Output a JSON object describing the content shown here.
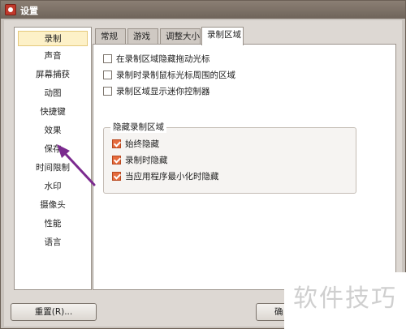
{
  "window": {
    "title": "设置"
  },
  "sidebar": {
    "items": [
      {
        "label": "录制",
        "selected": true
      },
      {
        "label": "声音"
      },
      {
        "label": "屏幕捕获"
      },
      {
        "label": "动图"
      },
      {
        "label": "快捷键"
      },
      {
        "label": "效果"
      },
      {
        "label": "保存"
      },
      {
        "label": "时间限制"
      },
      {
        "label": "水印"
      },
      {
        "label": "摄像头"
      },
      {
        "label": "性能"
      },
      {
        "label": "语言"
      }
    ]
  },
  "tabs": [
    {
      "label": "常规"
    },
    {
      "label": "游戏"
    },
    {
      "label": "调整大小"
    },
    {
      "label": "录制区域",
      "active": true
    }
  ],
  "panel": {
    "options": [
      {
        "label": "在录制区域隐藏拖动光标",
        "checked": false
      },
      {
        "label": "录制时录制鼠标光标周围的区域",
        "checked": false
      },
      {
        "label": "录制区域显示迷你控制器",
        "checked": false
      }
    ],
    "group": {
      "legend": "隐藏录制区域",
      "options": [
        {
          "label": "始终隐藏",
          "checked": true
        },
        {
          "label": "录制时隐藏",
          "checked": true
        },
        {
          "label": "当应用程序最小化时隐藏",
          "checked": true
        }
      ]
    }
  },
  "footer": {
    "reset_label": "重置(R)...",
    "ok_label": "确"
  },
  "watermark": {
    "text": "软件技巧"
  },
  "colors": {
    "check_accent": "#e56b3d",
    "arrow": "#7b2a8f",
    "selected_bg": "#fdf1c8"
  }
}
